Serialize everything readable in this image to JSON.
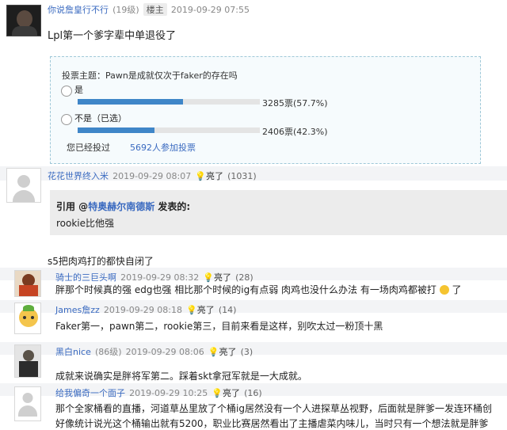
{
  "post1": {
    "username": "你说詹皇行不行",
    "level": "(19级)",
    "floor_tag": "楼主",
    "time": "2019-09-29 07:55",
    "title": "Lpl第一个爹字辈中单退役了"
  },
  "poll": {
    "topic": "投票主题：Pawn是成就仅次于faker的存在吗",
    "options": [
      {
        "label": "是",
        "votes": "3285票(57.7%)",
        "fraction": 0.577
      },
      {
        "label": "不是（已选）",
        "votes": "2406票(42.3%)",
        "fraction": 0.423
      }
    ],
    "voted_status": "您已经投过",
    "participants": "5692人参加投票"
  },
  "reply1": {
    "username": "花花世界终入米",
    "time": "2019-09-29 08:07",
    "like_label": "亮了",
    "like_count": "(1031)",
    "quote_prefix": "引用 @",
    "quote_user": "特奥赫尔南德斯",
    "quote_suffix": " 发表的:",
    "quote_text": "rookie比他强",
    "text": "s5把肉鸡打的都快自闭了"
  },
  "reply2": {
    "username": "骑士的三巨头啊",
    "time": "2019-09-29 08:32",
    "like_label": "亮了",
    "like_count": "(28)",
    "text": "胖那个时候真的强 edg也强 相比那个时候的ig有点弱 肉鸡也没什么办法 有一场肉鸡都被打",
    "text_tail": "了"
  },
  "reply3": {
    "username": "James詹zz",
    "time": "2019-09-29 08:18",
    "like_label": "亮了",
    "like_count": "(14)",
    "text": "Faker第一，pawn第二，rookie第三，目前来看是这样，别吹太过一粉顶十黑"
  },
  "reply4": {
    "username": "黑白nice",
    "level": "(86级)",
    "time": "2019-09-29 08:06",
    "like_label": "亮了",
    "like_count": "(3)",
    "text": "成就来说确实是胖将军第二。踩着skt拿冠军就是一大成就。"
  },
  "reply5": {
    "username": "给我偏奇一个面子",
    "time": "2019-09-29 10:25",
    "like_label": "亮了",
    "like_count": "(16)",
    "text_line1": "那个全家桶看的直播，河道草丛里放了个桶ig居然没有一个人进探草丛视野，后面就是胖爹一发连环桶创",
    "text_line2": "好像统计说光这个桶输出就有5200，职业比赛居然看出了主播虐菜内味儿，当时只有一个想法就是胖爹"
  },
  "colors": {
    "accent": "#3a6ac0",
    "bar": "#3f86c8",
    "poll_border": "#9fc8d8"
  }
}
